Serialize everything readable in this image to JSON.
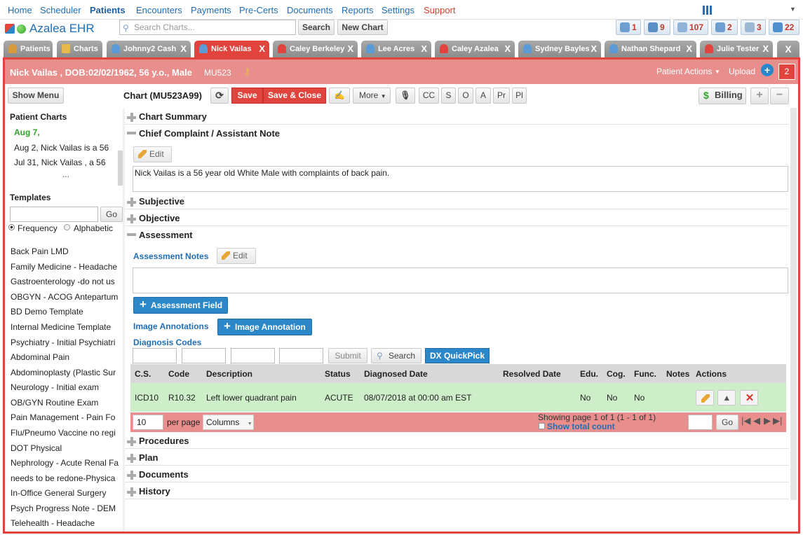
{
  "nav": {
    "items": [
      "Home",
      "Scheduler",
      "Patients",
      "Encounters",
      "Payments",
      "Pre-Certs",
      "Documents",
      "Reports",
      "Settings",
      "Support"
    ]
  },
  "app": {
    "title": "Azalea EHR"
  },
  "search": {
    "placeholder": "Search Charts...",
    "button": "Search",
    "new_chart": "New Chart"
  },
  "counters": [
    "1",
    "9",
    "107",
    "2",
    "3",
    "22"
  ],
  "tabs": [
    "Patients",
    "Charts",
    "Johnny2 Cash",
    "Nick Vailas",
    "Caley Berkeley",
    "Lee Acres",
    "Caley Azalea",
    "Sydney Bayles",
    "Nathan Shepard",
    "Julie Tester"
  ],
  "tab_close": "X",
  "patient": {
    "banner": "Nick Vailas , DOB:02/02/1962, 56 y.o., Male",
    "mrn": "MU523",
    "actions": "Patient Actions",
    "upload": "Upload",
    "badge": "2"
  },
  "toolbar": {
    "show_menu": "Show Menu",
    "chart_title": "Chart (MU523A99)",
    "save": "Save",
    "save_close": "Save & Close",
    "more": "More",
    "shortcuts": [
      "CC",
      "S",
      "O",
      "A",
      "Pr",
      "Pl"
    ],
    "billing": "Billing"
  },
  "left": {
    "patient_charts_title": "Patient Charts",
    "charts": [
      "Aug 7,",
      "Aug 2, Nick Vailas is a 56",
      "Jul 31, Nick Vailas , a 56",
      "..."
    ],
    "templates_title": "Templates",
    "go": "Go",
    "sort_options": [
      "Frequency",
      "Alphabetic"
    ],
    "templates": [
      "Back Pain LMD",
      "Family Medicine - Headache",
      "Gastroenterology -do not us",
      "OBGYN - ACOG Antepartum",
      "BD Demo Template",
      "Internal Medicine Template",
      "Psychiatry - Initial Psychiatri",
      "Abdominal Pain",
      "Abdominoplasty (Plastic Sur",
      "Neurology - Initial exam",
      "OB/GYN Routine Exam",
      "Pain Management - Pain Fo",
      "Flu/Pneumo Vaccine no regi",
      "DOT Physical",
      "Nephrology - Acute Renal Fa",
      "needs to be redone-Physica",
      "In-Office General Surgery",
      "Psych Progress Note - DEM",
      "Telehealth - Headache"
    ]
  },
  "sections": {
    "chart_summary": "Chart Summary",
    "chief_complaint": "Chief Complaint / Assistant Note",
    "edit": "Edit",
    "cc_text": "Nick Vailas is a 56 year old White Male with complaints of back pain.",
    "subjective": "Subjective",
    "objective": "Objective",
    "assessment": "Assessment",
    "assessment_notes": "Assessment Notes",
    "assessment_field": "Assessment Field",
    "image_annotations": "Image Annotations",
    "image_annotation_btn": "Image Annotation",
    "diagnosis_codes": "Diagnosis Codes",
    "submit": "Submit",
    "search": "Search",
    "dx_quickpick": "DX QuickPick",
    "procedures": "Procedures",
    "plan": "Plan",
    "documents": "Documents",
    "history": "History"
  },
  "dx_table": {
    "headers": [
      "C.S.",
      "Code",
      "Description",
      "Status",
      "Diagnosed Date",
      "Resolved Date",
      "Edu.",
      "Cog.",
      "Func.",
      "Notes",
      "Actions"
    ],
    "rows": [
      [
        "ICD10",
        "R10.32",
        "Left lower quadrant pain",
        "ACUTE",
        "08/07/2018 at 00:00 am EST",
        "",
        "No",
        "No",
        "No",
        "",
        ""
      ]
    ]
  },
  "pager": {
    "per_page_value": "10",
    "per_page": "per page",
    "columns": "Columns",
    "showing": "Showing page 1 of 1 (1 - 1 of 1)",
    "show_total": "Show total count",
    "go": "Go"
  }
}
